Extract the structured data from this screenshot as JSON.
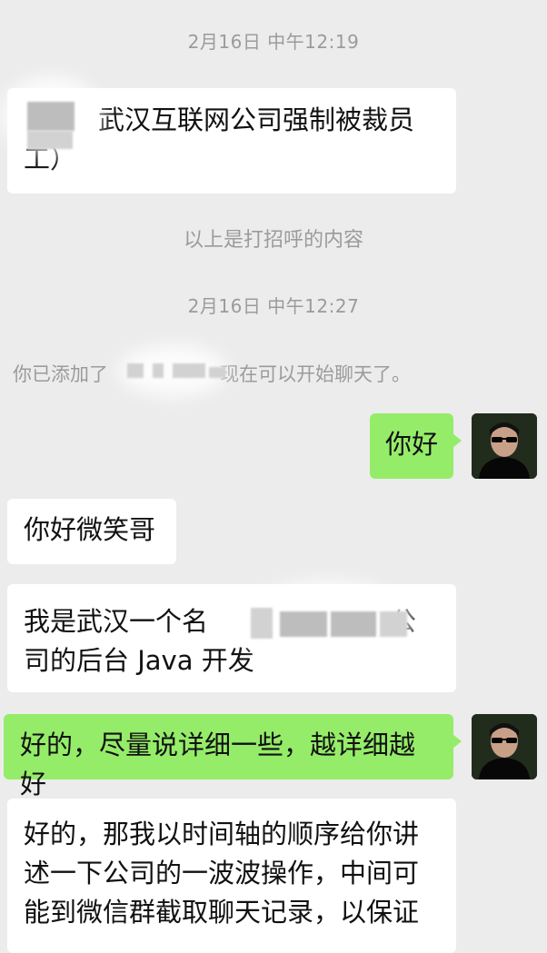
{
  "messages": {
    "ts1": "2月16日 中午12:19",
    "greet_line1": "武汉互联网公司强制被裁员",
    "greet_line2": "工）",
    "greet_note": "以上是打招呼的内容",
    "ts2": "2月16日 中午12:27",
    "added_prefix": "你已添加了",
    "added_suffix": "现在可以开始聊天了。",
    "out1": "你好",
    "in1": "你好微笑哥",
    "in2_line1a": "我是武汉一个名",
    "in2_line1b": "公",
    "in2_line2": "司的后台 Java 开发",
    "out2": "好的，尽量说详细一些，越详细越好",
    "in3_line1": "好的，那我以时间轴的顺序给你讲",
    "in3_line2": "述一下公司的一波波操作，中间可",
    "in3_line3": "能到微信群截取聊天记录，以保证"
  },
  "colors": {
    "background": "#ececec",
    "incoming_bubble": "#ffffff",
    "outgoing_bubble": "#95ec69",
    "system_text": "#9b9b9b"
  },
  "icons": {
    "avatar": "person-in-sunglasses-avatar-icon"
  }
}
